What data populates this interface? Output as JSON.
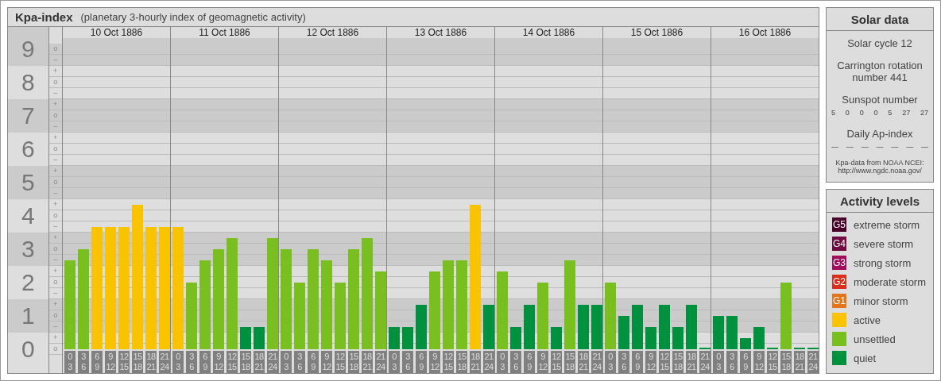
{
  "title": "Kpa-index",
  "subtitle": "(planetary 3-hourly index of geomagnetic activity)",
  "y_axis": [
    {
      "marks": [
        "o",
        "–"
      ]
    },
    {
      "marks": [
        "+",
        "o",
        "–"
      ]
    },
    {
      "marks": [
        "+",
        "o",
        "–"
      ]
    },
    {
      "marks": [
        "+",
        "o",
        "–"
      ]
    },
    {
      "marks": [
        "+",
        "o",
        "–"
      ]
    },
    {
      "marks": [
        "+",
        "o",
        "–"
      ]
    },
    {
      "marks": [
        "+",
        "o",
        "–"
      ]
    },
    {
      "marks": [
        "+",
        "o",
        "–"
      ]
    },
    {
      "marks": [
        "+",
        "o",
        "–"
      ]
    },
    {
      "marks": [
        "+",
        "o"
      ]
    }
  ],
  "days": [
    {
      "date": "10 Oct 1886"
    },
    {
      "date": "11 Oct 1886"
    },
    {
      "date": "12 Oct 1886"
    },
    {
      "date": "13 Oct 1886"
    },
    {
      "date": "14 Oct 1886"
    },
    {
      "date": "15 Oct 1886"
    },
    {
      "date": "16 Oct 1886"
    }
  ],
  "chart_data": {
    "type": "bar",
    "stacked": true,
    "grid": true,
    "ylim": [
      0,
      9
    ],
    "yticks": [
      0,
      1,
      2,
      3,
      4,
      5,
      6,
      7,
      8,
      9
    ],
    "categories": [
      "0 3",
      "3 6",
      "6 9",
      "9 12",
      "12 15",
      "15 18",
      "18 21",
      "21 24",
      "0 3",
      "3 6",
      "6 9",
      "9 12",
      "12 15",
      "15 18",
      "18 21",
      "21 24",
      "0 3",
      "3 6",
      "6 9",
      "9 12",
      "12 15",
      "15 18",
      "18 21",
      "21 24",
      "0 3",
      "3 6",
      "6 9",
      "9 12",
      "12 15",
      "15 18",
      "18 21",
      "21 24",
      "0 3",
      "3 6",
      "6 9",
      "9 12",
      "12 15",
      "15 18",
      "18 21",
      "21 24",
      "0 3",
      "3 6",
      "6 9",
      "9 12",
      "12 15",
      "15 18",
      "18 21",
      "21 24",
      "0 3",
      "3 6",
      "6 9",
      "9 12",
      "12 15",
      "15 18",
      "18 21",
      "21 24"
    ],
    "series": [
      {
        "name": "quiet",
        "color": "#00913e",
        "values": [
          null,
          null,
          null,
          null,
          null,
          null,
          null,
          null,
          null,
          null,
          null,
          null,
          null,
          0.67,
          0.67,
          null,
          null,
          null,
          null,
          null,
          null,
          null,
          null,
          null,
          0.67,
          0.67,
          1.33,
          null,
          null,
          null,
          null,
          1.33,
          null,
          0.67,
          1.33,
          null,
          0.67,
          null,
          1.33,
          1.33,
          null,
          1,
          1.33,
          0.67,
          1.33,
          0.67,
          1.33,
          0,
          1,
          1,
          0.33,
          0.67,
          0,
          null,
          0,
          0
        ]
      },
      {
        "name": "unsettled",
        "color": "#7abf20",
        "values": [
          2.67,
          3,
          null,
          null,
          null,
          null,
          null,
          null,
          null,
          2,
          2.67,
          3,
          3.33,
          null,
          null,
          3.33,
          3,
          2,
          3,
          2.67,
          2,
          3,
          3.33,
          2.33,
          null,
          null,
          null,
          2.33,
          2.67,
          2.67,
          null,
          null,
          2.33,
          null,
          null,
          2,
          null,
          2.67,
          null,
          null,
          2,
          null,
          null,
          null,
          null,
          null,
          null,
          null,
          null,
          null,
          null,
          null,
          null,
          2,
          null,
          null
        ]
      },
      {
        "name": "active",
        "color": "#f9c300",
        "values": [
          null,
          null,
          3.67,
          3.67,
          3.67,
          4.33,
          3.67,
          3.67,
          3.67,
          null,
          null,
          null,
          null,
          null,
          null,
          null,
          null,
          null,
          null,
          null,
          null,
          null,
          null,
          null,
          null,
          null,
          null,
          null,
          null,
          null,
          4.33,
          null,
          null,
          null,
          null,
          null,
          null,
          null,
          null,
          null,
          null,
          null,
          null,
          null,
          null,
          null,
          null,
          null,
          null,
          null,
          null,
          null,
          null,
          null,
          null,
          null
        ]
      }
    ]
  },
  "solar": {
    "title": "Solar data",
    "cycle": "Solar cycle 12",
    "rotation": "Carrington rotation number 441",
    "sunspot_label": "Sunspot number",
    "sunspots": [
      "5",
      "0",
      "0",
      "0",
      "5",
      "27",
      "27"
    ],
    "ap_label": "Daily Ap-index",
    "ap_values": [
      "—",
      "—",
      "—",
      "—",
      "—",
      "—",
      "—"
    ],
    "source": "Kpa-data from NOAA NCEI:",
    "source_url": "http://www.ngdc.noaa.gov/"
  },
  "legend": {
    "title": "Activity levels",
    "items": [
      {
        "badge": "G5",
        "label": "extreme storm",
        "color": "#4b0029"
      },
      {
        "badge": "G4",
        "label": "severe storm",
        "color": "#6e0a3f"
      },
      {
        "badge": "G3",
        "label": "strong storm",
        "color": "#a30b5d"
      },
      {
        "badge": "G2",
        "label": "moderate storm",
        "color": "#d8301c"
      },
      {
        "badge": "G1",
        "label": "minor storm",
        "color": "#e5741a"
      }
    ]
  }
}
